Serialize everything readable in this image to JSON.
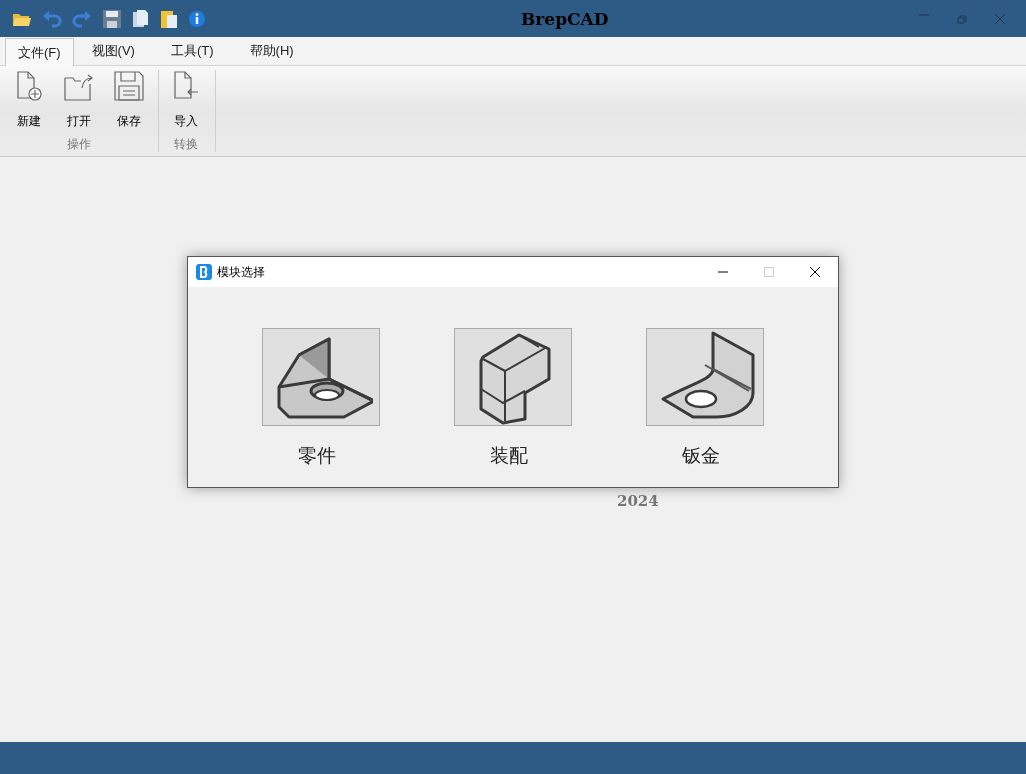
{
  "window": {
    "title": "BrepCAD"
  },
  "menu_tabs": [
    {
      "label": "文件(F)",
      "selected": true
    },
    {
      "label": "视图(V)",
      "selected": false
    },
    {
      "label": "工具(T)",
      "selected": false
    },
    {
      "label": "帮助(H)",
      "selected": false
    }
  ],
  "ribbon": {
    "groups": [
      {
        "label": "操作",
        "buttons": [
          {
            "label": "新建",
            "kind": "new"
          },
          {
            "label": "打开",
            "kind": "open"
          },
          {
            "label": "保存",
            "kind": "save"
          }
        ]
      },
      {
        "label": "转换",
        "buttons": [
          {
            "label": "导入",
            "kind": "import"
          }
        ]
      }
    ]
  },
  "background_text": "2024",
  "dialog": {
    "title": "模块选择",
    "modules": [
      {
        "label": "零件",
        "kind": "part"
      },
      {
        "label": "装配",
        "kind": "assembly"
      },
      {
        "label": "钣金",
        "kind": "sheet_metal"
      }
    ]
  }
}
